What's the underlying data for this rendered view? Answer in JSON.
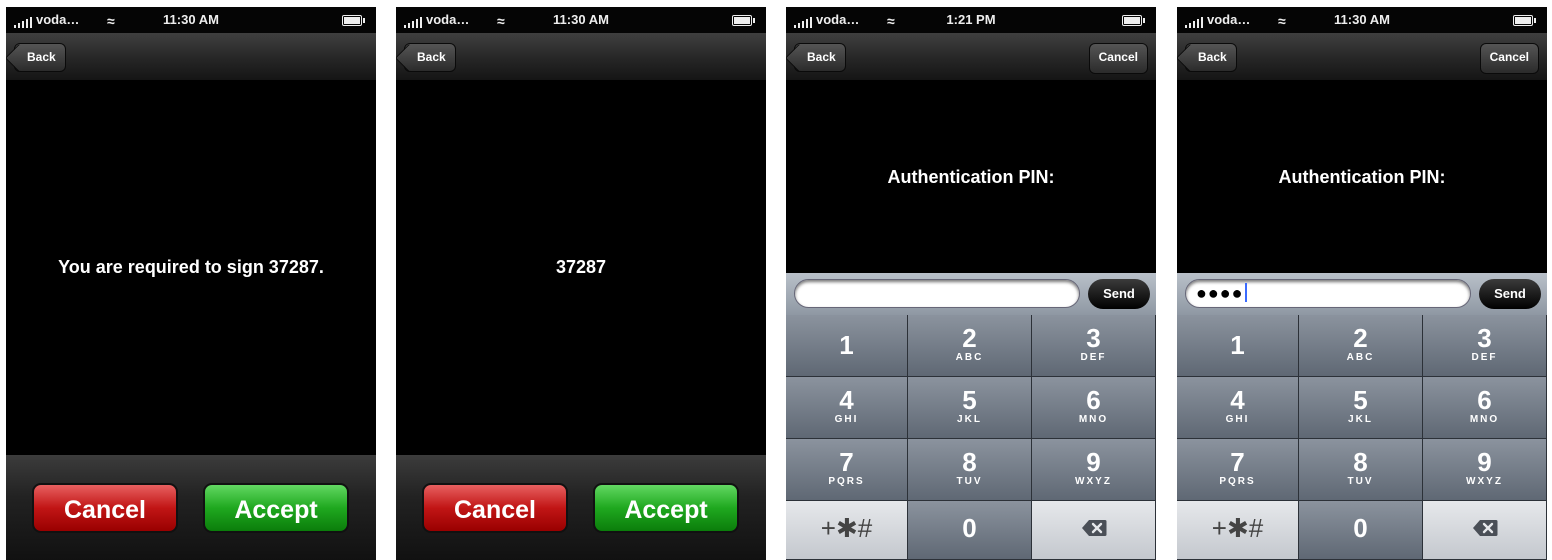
{
  "screens": [
    {
      "status": {
        "carrier": "voda…",
        "time": "11:30 AM"
      },
      "nav": {
        "back": "Back"
      },
      "message": "You are required to sign 37287.",
      "actions": {
        "cancel": "Cancel",
        "accept": "Accept"
      }
    },
    {
      "status": {
        "carrier": "voda…",
        "time": "11:30 AM"
      },
      "nav": {
        "back": "Back"
      },
      "message": "37287",
      "actions": {
        "cancel": "Cancel",
        "accept": "Accept"
      }
    },
    {
      "status": {
        "carrier": "voda…",
        "time": "1:21 PM"
      },
      "nav": {
        "back": "Back",
        "cancel": "Cancel"
      },
      "title": "Authentication PIN:",
      "pin_value": "",
      "send": "Send"
    },
    {
      "status": {
        "carrier": "voda…",
        "time": "11:30 AM"
      },
      "nav": {
        "back": "Back",
        "cancel": "Cancel"
      },
      "title": "Authentication PIN:",
      "pin_value": "●●●●",
      "send": "Send"
    }
  ],
  "keypad": {
    "keys": [
      {
        "digit": "1",
        "letters": ""
      },
      {
        "digit": "2",
        "letters": "ABC"
      },
      {
        "digit": "3",
        "letters": "DEF"
      },
      {
        "digit": "4",
        "letters": "GHI"
      },
      {
        "digit": "5",
        "letters": "JKL"
      },
      {
        "digit": "6",
        "letters": "MNO"
      },
      {
        "digit": "7",
        "letters": "PQRS"
      },
      {
        "digit": "8",
        "letters": "TUV"
      },
      {
        "digit": "9",
        "letters": "WXYZ"
      }
    ],
    "symbols_label": "+✱#",
    "zero": "0",
    "delete_icon": "backspace-icon"
  }
}
